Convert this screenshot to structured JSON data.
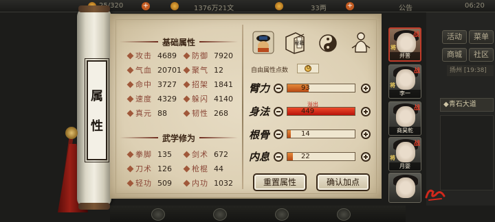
{
  "topbar": {
    "resource_a": "25/320",
    "resource_b": "1376万21文",
    "resource_c": "33两",
    "announcement": "公告",
    "clock": "06:20"
  },
  "side_menu": [
    {
      "label": "活动"
    },
    {
      "label": "菜单"
    },
    {
      "label": "商城"
    },
    {
      "label": "社区"
    }
  ],
  "side_note": "扬州 [19:38]",
  "side_quest": "◆青石大道",
  "scroll": {
    "title_chars": [
      "属",
      "性"
    ]
  },
  "basic": {
    "heading": "基础属性",
    "stats": [
      {
        "name": "攻击",
        "value": "4689"
      },
      {
        "name": "防御",
        "value": "7920"
      },
      {
        "name": "气血",
        "value": "20701"
      },
      {
        "name": "聚气",
        "value": "12"
      },
      {
        "name": "命中",
        "value": "3727"
      },
      {
        "name": "招架",
        "value": "1841"
      },
      {
        "name": "速度",
        "value": "4329"
      },
      {
        "name": "躲闪",
        "value": "4140"
      },
      {
        "name": "真元",
        "value": "88"
      },
      {
        "name": "韧性",
        "value": "268"
      }
    ]
  },
  "martial": {
    "heading": "武学修为",
    "stats": [
      {
        "name": "拳脚",
        "value": "135"
      },
      {
        "name": "剑术",
        "value": "672"
      },
      {
        "name": "刀术",
        "value": "126"
      },
      {
        "name": "枪棍",
        "value": "44"
      },
      {
        "name": "轻功",
        "value": "509"
      },
      {
        "name": "内功",
        "value": "1032"
      }
    ]
  },
  "categories": [
    {
      "icon": "character-hat-icon"
    },
    {
      "icon": "book-tome-icon",
      "label": "秘籍"
    },
    {
      "icon": "taiji-icon"
    },
    {
      "icon": "meridian-body-icon"
    }
  ],
  "free_points": {
    "label": "自由属性点数",
    "value": "0"
  },
  "attributes": [
    {
      "name": "臂力",
      "value": "93",
      "fill_percent": 32,
      "overflow": false
    },
    {
      "name": "身法",
      "value": "449",
      "fill_percent": 100,
      "overflow": true
    },
    {
      "name": "根骨",
      "value": "14",
      "fill_percent": 5,
      "overflow": false
    },
    {
      "name": "内息",
      "value": "22",
      "fill_percent": 8,
      "overflow": false
    }
  ],
  "overflow_label": "溢出",
  "buttons": {
    "reset": "重置属性",
    "confirm": "确认加点"
  },
  "characters": [
    {
      "name": "并普",
      "tag": "战",
      "mark": "将",
      "selected": true
    },
    {
      "name": "李一",
      "tag": "战",
      "mark": "将",
      "selected": false
    },
    {
      "name": "商昊乾",
      "tag": "战",
      "mark": "",
      "selected": false
    },
    {
      "name": "月婴",
      "tag": "战",
      "mark": "将",
      "selected": false
    },
    {
      "name": "",
      "tag": "",
      "mark": "",
      "selected": false
    }
  ],
  "colors": {
    "accent_red": "#c03c2a",
    "paper": "#e7dcc4",
    "ink": "#1a130c",
    "bar_fill": "#c8601e",
    "bar_overflow": "#d22c14"
  }
}
